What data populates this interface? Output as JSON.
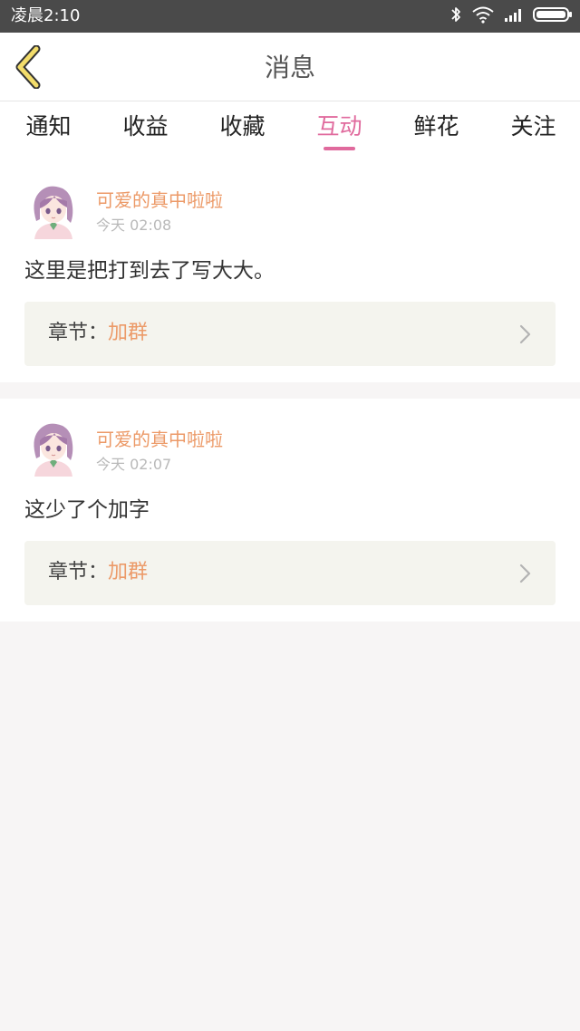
{
  "status_bar": {
    "time": "凌晨2:10",
    "icons": [
      "bluetooth-icon",
      "wifi-icon",
      "signal-icon",
      "battery-icon"
    ]
  },
  "header": {
    "title": "消息",
    "back_icon": "chevron-left-icon"
  },
  "tabs": [
    {
      "label": "通知"
    },
    {
      "label": "收益"
    },
    {
      "label": "收藏"
    },
    {
      "label": "互动",
      "active": true
    },
    {
      "label": "鲜花"
    },
    {
      "label": "关注"
    }
  ],
  "messages": [
    {
      "username": "可爱的真中啦啦",
      "time": "今天 02:08",
      "content": "这里是把打到去了写大大。",
      "chapter_prefix": "章节：",
      "chapter_name": "加群"
    },
    {
      "username": "可爱的真中啦啦",
      "time": "今天 02:07",
      "content": "这少了个加字",
      "chapter_prefix": "章节：",
      "chapter_name": "加群"
    }
  ],
  "colors": {
    "accent": "#e06a9d",
    "username": "#ec9a68",
    "status_bar": "#4a4a4a",
    "back_icon_fill": "#f3dd6b"
  }
}
